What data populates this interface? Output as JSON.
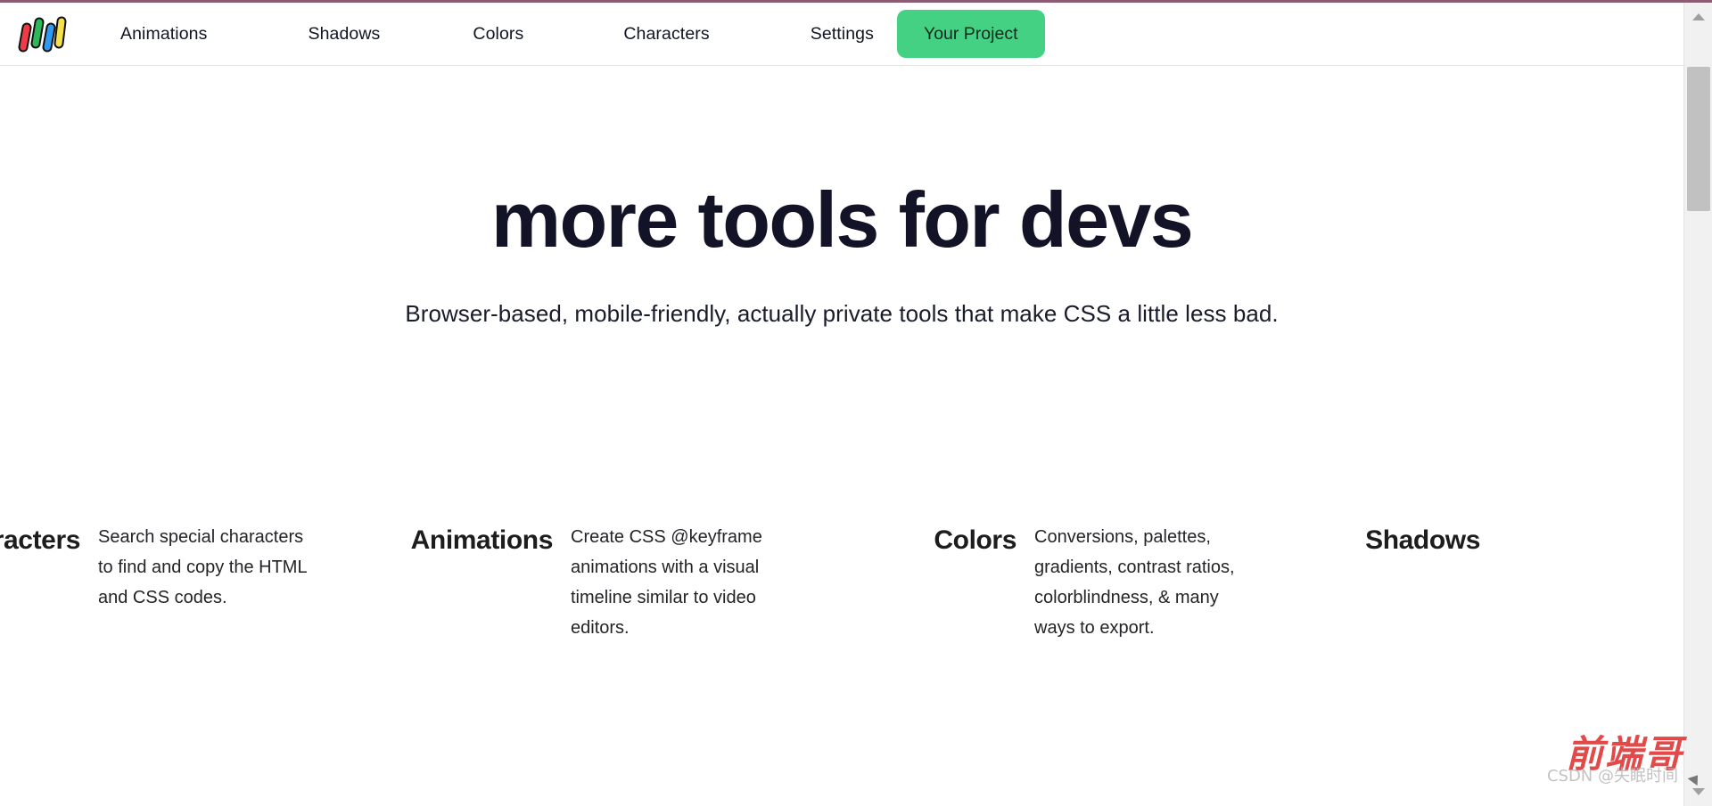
{
  "theme": {
    "top_accent_color": "#8c5c74",
    "cta_background": "#45d183",
    "cta_text_color": "#0f2b1d",
    "heading_color": "#121327",
    "body_text_color": "#232427",
    "header_border_color": "#e7e7ea",
    "page_background": "#ffffff",
    "scrollbar_track": "#f1f1f1",
    "scrollbar_thumb": "#c1c1c1"
  },
  "header": {
    "logo": {
      "name": "brand-logo-bars",
      "bars": [
        {
          "fill": "#ef3b45",
          "stroke": "#111111"
        },
        {
          "fill": "#2eb85c",
          "stroke": "#111111"
        },
        {
          "fill": "#2e9bf0",
          "stroke": "#111111"
        },
        {
          "fill": "#f5e04a",
          "stroke": "#111111"
        }
      ]
    },
    "nav": [
      {
        "label": "Animations"
      },
      {
        "label": "Shadows"
      },
      {
        "label": "Colors"
      },
      {
        "label": "Characters"
      },
      {
        "label": "Settings"
      }
    ],
    "cta": {
      "label": "Your Project"
    }
  },
  "hero": {
    "title": "more tools for devs",
    "subtitle": "Browser-based, mobile-friendly, actually private tools that make CSS a little less bad."
  },
  "features": [
    {
      "title": "racters",
      "full_title": "Characters",
      "description": "Search special characters to find and copy the HTML and CSS codes."
    },
    {
      "title": "Animations",
      "full_title": "Animations",
      "description": "Create CSS @keyframe animations with a visual timeline similar to video editors."
    },
    {
      "title": "Colors",
      "full_title": "Colors",
      "description": "Conversions, palettes, gradients, contrast ratios, colorblindness, & many ways to export."
    },
    {
      "title": "Shadows",
      "full_title": "Shadows",
      "description": ""
    }
  ],
  "scrollbar": {
    "up_arrow": "scroll-up-arrow",
    "down_arrow": "scroll-down-arrow"
  },
  "watermark": {
    "brand": "前端哥",
    "credit": "CSDN @失眠时间"
  }
}
